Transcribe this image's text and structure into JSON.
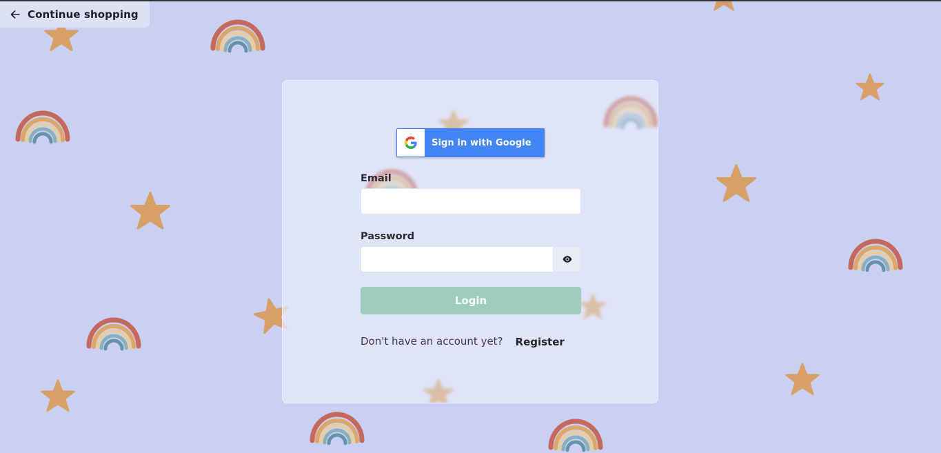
{
  "nav": {
    "back_label": "Continue shopping",
    "back_icon": "arrow-left-icon"
  },
  "login": {
    "google_label": "Sign in with Google",
    "google_icon": "google-logo-icon",
    "email_label": "Email",
    "email_value": "",
    "email_placeholder": "",
    "password_label": "Password",
    "password_value": "",
    "password_placeholder": "",
    "password_toggle_icon": "eye-icon",
    "login_label": "Login",
    "register_prompt": "Don't have an account yet?",
    "register_label": "Register"
  },
  "theme": {
    "background": "#cad0f2",
    "card": "#e9ebfa",
    "google_blue": "#4285f4",
    "login_button": "#a0ccc0",
    "star": "#d6a067",
    "rainbow": [
      "#c4695f",
      "#dba86a",
      "#e6cda2",
      "#8bb0bd",
      "#6792ad"
    ]
  },
  "background_pattern": {
    "icons": [
      "rainbow-icon",
      "star-icon"
    ]
  }
}
